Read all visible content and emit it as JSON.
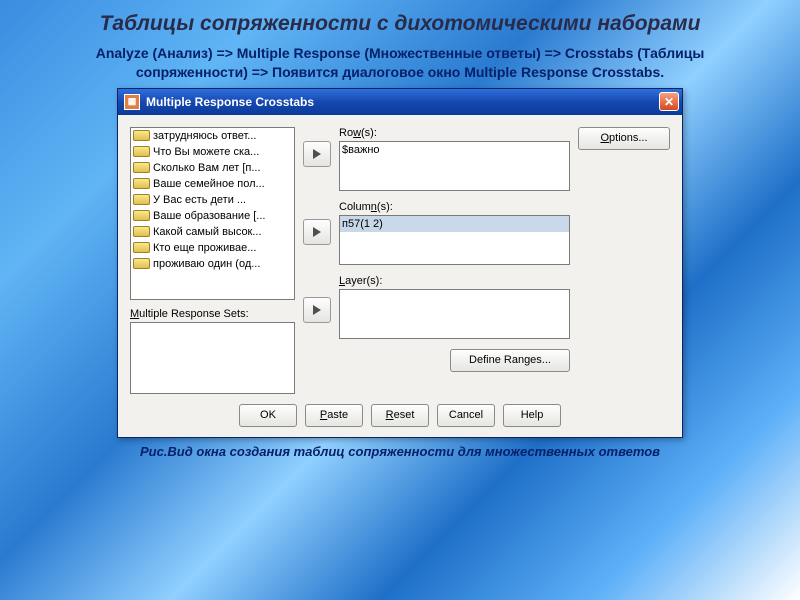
{
  "slide": {
    "title": "Таблицы сопряженности с дихотомическими наборами",
    "subtitle": "Analyze (Анализ) => Multiple Response (Множественные ответы) => Crosstabs (Таблицы сопряженности) => Появится диалоговое окно Multiple Response Crosstabs.",
    "caption": "Рис.Вид окна создания таблиц сопряженности для множественных ответов"
  },
  "dialog": {
    "title": "Multiple Response Crosstabs",
    "variables_label": "",
    "variables": [
      "затрудняюсь ответ...",
      "Что Вы можете ска...",
      "Сколько Вам лет [п...",
      "Ваше семейное пол...",
      "У Вас есть дети ...",
      "Ваше образование [...",
      "Какой самый высок...",
      "Кто еще проживае...",
      "проживаю один (од..."
    ],
    "sets_label": "Multiple Response Sets:",
    "rows_label": "Row(s):",
    "rows": [
      "$важно"
    ],
    "columns_label": "Column(s):",
    "columns": [
      "п57(1 2)"
    ],
    "column_selected_index": 0,
    "layers_label": "Layer(s):",
    "layers": [],
    "buttons": {
      "options": "Options...",
      "define_ranges": "Define Ranges...",
      "ok": "OK",
      "paste": "Paste",
      "reset": "Reset",
      "cancel": "Cancel",
      "help": "Help"
    }
  }
}
